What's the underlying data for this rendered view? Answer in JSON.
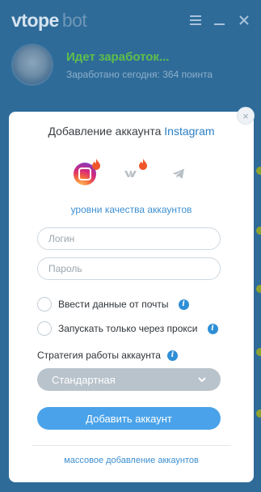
{
  "app": {
    "logo_main": "vtope",
    "logo_sub": "bot",
    "status_title": "Идет заработок...",
    "status_sub": "Заработано сегодня: 364 поинта"
  },
  "window_controls": [
    "menu-icon",
    "minimize-icon",
    "close-icon"
  ],
  "modal": {
    "title_prefix": "Добавление аккаунта",
    "title_accent": "Instagram",
    "close_symbol": "×",
    "platforms": [
      {
        "name": "instagram-icon",
        "selected": true
      },
      {
        "name": "vk-icon",
        "selected": false
      },
      {
        "name": "telegram-icon",
        "selected": false
      }
    ],
    "quality_link": "уровни качества аккаунтов",
    "login_placeholder": "Логин",
    "password_placeholder": "Пароль",
    "checkbox_email": "Ввести данные от почты",
    "checkbox_proxy": "Запускать только через прокси",
    "strategy_label": "Стратегия работы аккаунта",
    "strategy_value": "Стандартная",
    "submit_label": "Добавить аккаунт",
    "mass_link": "массовое добавление аккаунтов",
    "info_glyph": "i"
  },
  "colors": {
    "accent": "#2a7fc4",
    "primary_button": "#4aa3ea",
    "status_green": "#5fbf4a",
    "background": "#2e6b99"
  }
}
